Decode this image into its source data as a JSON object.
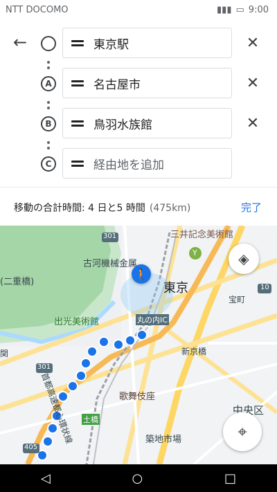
{
  "status": {
    "carrier": "NTT DOCOMO",
    "time": "9:00"
  },
  "route": {
    "stops": [
      {
        "marker": "",
        "value": "東京駅",
        "placeholder": false
      },
      {
        "marker": "A",
        "value": "名古屋市",
        "placeholder": false
      },
      {
        "marker": "B",
        "value": "鳥羽水族館",
        "placeholder": false
      },
      {
        "marker": "C",
        "value": "経由地を追加",
        "placeholder": true
      }
    ],
    "summary": "移動の合計時間: 4 日と5 時間",
    "distance": "(475km)",
    "done_label": "完了"
  },
  "map": {
    "labels": {
      "mitsui": "三井記念美術館",
      "furukawa": "古河機械金属",
      "tokyo": "東京",
      "nijubashi": "(二重橋)",
      "idemitsu": "出光美術館",
      "marunouchi_ic": "丸の内IC",
      "shinkyobashi": "新京橋",
      "takaracho": "宝町",
      "kabukiza": "歌舞伎座",
      "chuo": "中央区",
      "tsukiji": "築地市場",
      "tsuchihashi": "土橋",
      "expressway": "首都高速都心環状線",
      "r301a": "301",
      "r301b": "301",
      "r405": "405",
      "r10": "10",
      "y": "Y",
      "seki": "関"
    }
  },
  "colors": {
    "accent": "#1a73e8",
    "route": "#1a73e8"
  }
}
